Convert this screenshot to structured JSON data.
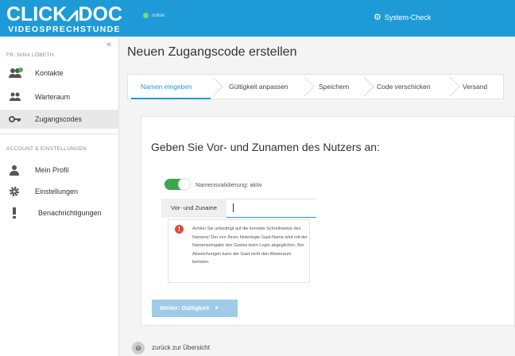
{
  "header": {
    "logo_main": "CLICK⩘DOC",
    "logo_sub": "VIDEOSPRECHSTUNDE",
    "status": "online",
    "system_check": "System-Check",
    "accent": "#1e9bd7"
  },
  "sidebar": {
    "user": "FR. NINA LÖBETH",
    "collapse": "«",
    "items": [
      {
        "label": "Kontakte",
        "icon": "contacts-icon"
      },
      {
        "label": "Warteraum",
        "icon": "waiting-room-icon"
      },
      {
        "label": "Zugangscodes",
        "icon": "key-icon"
      }
    ],
    "section": "ACCOUNT & EINSTELLUNGEN",
    "settings": [
      {
        "label": "Mein Profil",
        "icon": "person-icon"
      },
      {
        "label": "Einstellungen",
        "icon": "gear-icon"
      },
      {
        "label": "Benachrichtigungen",
        "icon": "exclamation-icon"
      }
    ]
  },
  "main": {
    "title": "Neuen Zugangscode erstellen",
    "steps": [
      "Namen eingeben",
      "Gültigkeit anpassen",
      "Speichern",
      "Code verschicken",
      "Versand"
    ],
    "card": {
      "heading": "Geben Sie Vor- und Zunamen des Nutzers an:",
      "toggle_label": "Namensvalidierung: aktiv",
      "name_label": "Vor- und Zuname",
      "name_value": "",
      "warning": "Achten Sie unbedingt auf die korrekte Schreibweise des Namens! Der von Ihnen hinterlegte Gast-Name wird mit der Namenseingabe des Gastes beim Login abgeglichen. Bei Abweichungen kann der Gast nicht den Warteraum betreten.",
      "next_button": "Weiter: Gültigkeit",
      "next_arrow": "▸"
    },
    "back_link": "zurück zur Übersicht",
    "back_icon": "⊖"
  }
}
